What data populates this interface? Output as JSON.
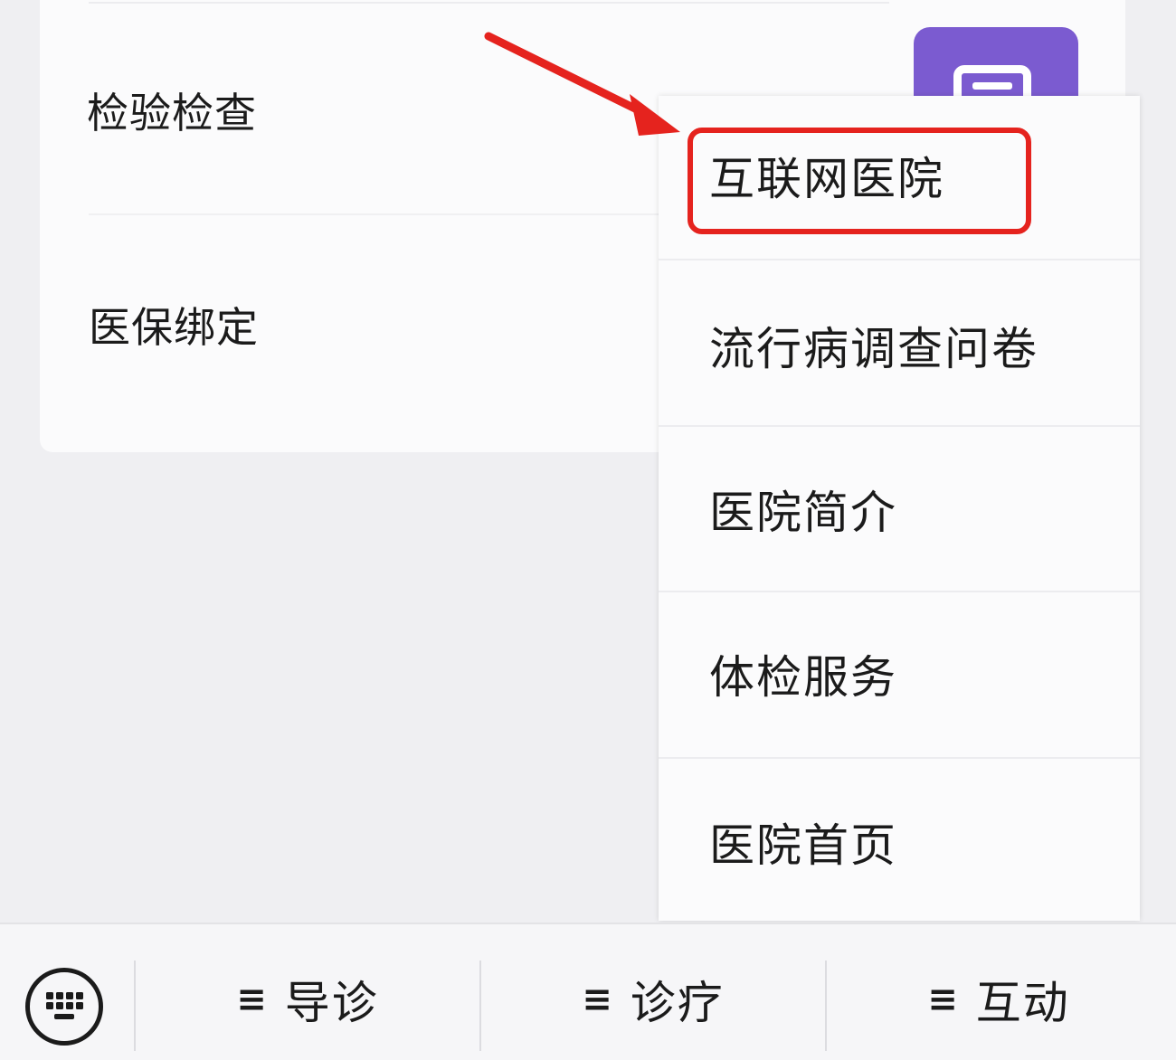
{
  "card": {
    "items": [
      {
        "label": "检验检查"
      },
      {
        "label": "医保绑定"
      }
    ]
  },
  "popup_menu": {
    "items": [
      {
        "label": "互联网医院",
        "highlighted": true
      },
      {
        "label": "流行病调查问卷"
      },
      {
        "label": "医院简介"
      },
      {
        "label": "体检服务"
      },
      {
        "label": "医院首页"
      }
    ]
  },
  "bottom_bar": {
    "keyboard_icon": "keyboard-icon",
    "menus": [
      {
        "icon": "≡",
        "label": "导诊"
      },
      {
        "icon": "≡",
        "label": "诊疗"
      },
      {
        "icon": "≡",
        "label": "互动"
      }
    ]
  },
  "colors": {
    "highlight": "#e5231e",
    "accent_purple": "#7b5bd0",
    "background": "#efeff2"
  }
}
